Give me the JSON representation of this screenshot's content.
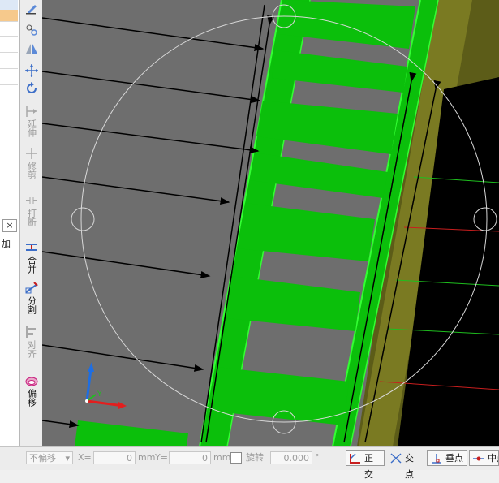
{
  "left_panel": {
    "close_glyph": "×",
    "text": "加"
  },
  "toolbar": {
    "tools": [
      {
        "id": "extend",
        "label": "延伸",
        "icon": "extend-icon",
        "enabled": false
      },
      {
        "id": "trim",
        "label": "修剪",
        "icon": "trim-icon",
        "enabled": false
      },
      {
        "id": "break",
        "label": "打断",
        "icon": "break-icon",
        "enabled": false
      },
      {
        "id": "merge",
        "label": "合并",
        "icon": "merge-icon",
        "enabled": true
      },
      {
        "id": "split",
        "label": "分割",
        "icon": "split-icon",
        "enabled": true
      },
      {
        "id": "align",
        "label": "对齐",
        "icon": "align-icon",
        "enabled": false
      },
      {
        "id": "offset",
        "label": "偏移",
        "icon": "offset-icon",
        "enabled": true
      }
    ]
  },
  "status_bar": {
    "offset_mode": "不偏移",
    "x_label": "X=",
    "x_value": "0",
    "x_unit": "mm",
    "y_label": "Y=",
    "y_value": "0",
    "y_unit": "mm",
    "rotate_label": "旋转",
    "rotate_value": "0.000",
    "rotate_unit": "°",
    "snaps": [
      {
        "id": "ortho",
        "label": "正交"
      },
      {
        "id": "intersection",
        "label": "交点"
      },
      {
        "id": "perpendicular",
        "label": "垂点"
      },
      {
        "id": "midpoint",
        "label": "中点"
      }
    ]
  },
  "colors": {
    "slab": "#6e6e6e",
    "beam": "#0bbf0b",
    "beam_edge": "#33ff33",
    "wall": "#6a6a1c",
    "axis_x": "#e31e1e",
    "axis_y": "#1e6ee3",
    "axis_z": "#1ebf1e"
  }
}
